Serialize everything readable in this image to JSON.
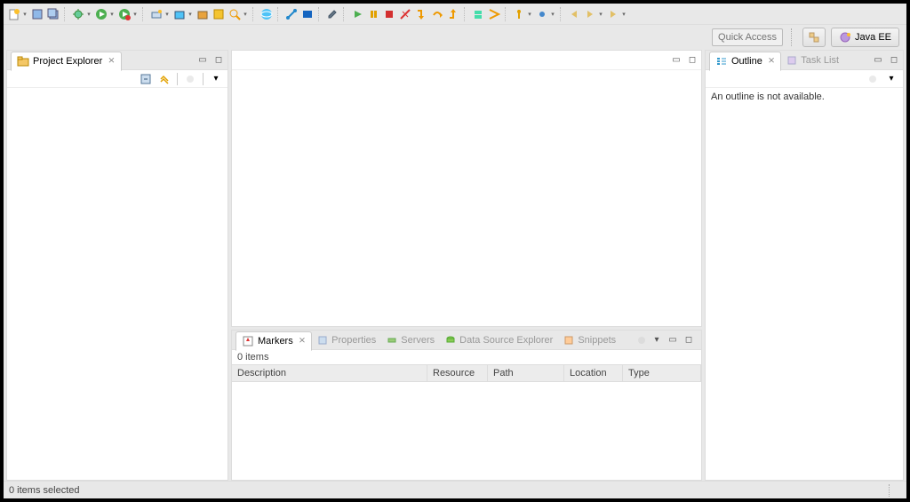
{
  "quick_access": {
    "placeholder": "Quick Access"
  },
  "perspective": {
    "java_ee": "Java EE"
  },
  "project_explorer": {
    "title": "Project Explorer"
  },
  "outline": {
    "title": "Outline",
    "empty_message": "An outline is not available."
  },
  "task_list": {
    "title": "Task List"
  },
  "markers": {
    "title": "Markers",
    "items_count": "0 items",
    "columns": {
      "description": "Description",
      "resource": "Resource",
      "path": "Path",
      "location": "Location",
      "type": "Type"
    }
  },
  "tabs": {
    "properties": "Properties",
    "servers": "Servers",
    "data_source_explorer": "Data Source Explorer",
    "snippets": "Snippets"
  },
  "status": {
    "selection": "0 items selected"
  }
}
